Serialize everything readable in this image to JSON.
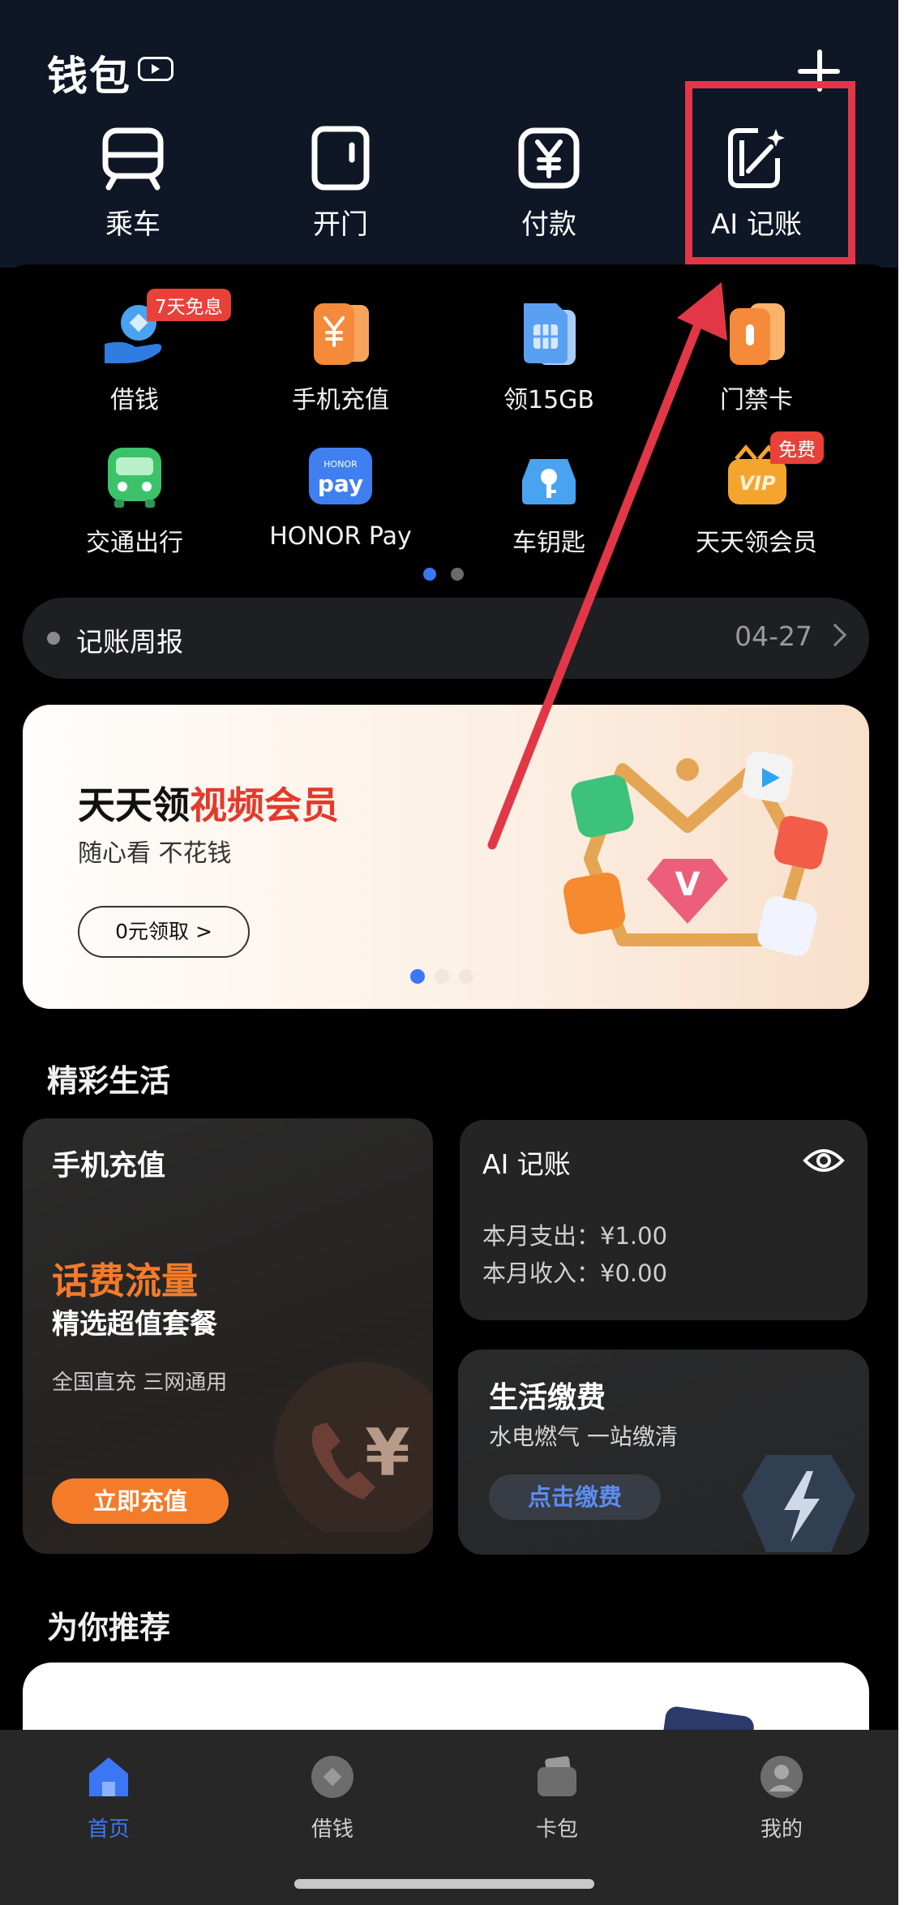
{
  "header": {
    "title": "钱包",
    "quick_actions": [
      {
        "label": "乘车",
        "icon": "bus-icon"
      },
      {
        "label": "开门",
        "icon": "door-icon"
      },
      {
        "label": "付款",
        "icon": "yuan-icon"
      },
      {
        "label": "AI 记账",
        "icon": "ai-ledger-icon"
      }
    ]
  },
  "services": [
    {
      "label": "借钱",
      "icon": "loan-icon",
      "tag": "7天免息"
    },
    {
      "label": "手机充值",
      "icon": "phone-recharge-icon"
    },
    {
      "label": "领15GB",
      "icon": "sim-card-icon"
    },
    {
      "label": "门禁卡",
      "icon": "access-card-icon"
    },
    {
      "label": "交通出行",
      "icon": "transit-icon"
    },
    {
      "label": "HONOR Pay",
      "icon": "honor-pay-icon"
    },
    {
      "label": "车钥匙",
      "icon": "car-key-icon"
    },
    {
      "label": "天天领会员",
      "icon": "vip-icon",
      "tag": "免费"
    }
  ],
  "report": {
    "title": "记账周报",
    "date": "04-27"
  },
  "banner": {
    "title_black": "天天领",
    "title_red": "视频会员",
    "subtitle": "随心看 不花钱",
    "button": "0元领取  >"
  },
  "sections": {
    "life": "精彩生活",
    "recommend": "为你推荐"
  },
  "recharge_card": {
    "title": "手机充值",
    "highlight": "话费流量",
    "subtitle": "精选超值套餐",
    "note": "全国直充 三网通用",
    "button": "立即充值"
  },
  "ledger_card": {
    "title": "AI 记账",
    "expense": "本月支出：¥1.00",
    "income": "本月收入：¥0.00"
  },
  "bills_card": {
    "title": "生活缴费",
    "subtitle": "水电燃气 一站缴清",
    "button": "点击缴费"
  },
  "bottom_nav": [
    {
      "label": "首页",
      "active": true
    },
    {
      "label": "借钱",
      "active": false
    },
    {
      "label": "卡包",
      "active": false
    },
    {
      "label": "我的",
      "active": false
    }
  ],
  "colors": {
    "header_bg": "#0f1626",
    "accent_blue": "#3b77f5",
    "accent_orange": "#f47b2a",
    "annotation_red": "#e23747"
  }
}
